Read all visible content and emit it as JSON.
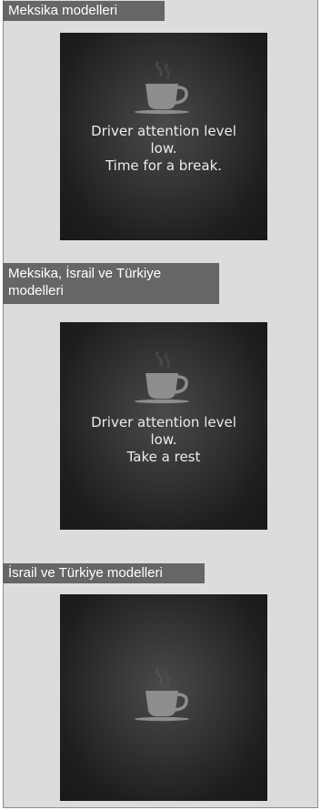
{
  "sections": [
    {
      "header": "Meksika modelleri",
      "message": [
        "Driver attention level",
        "low.",
        "Time for a break."
      ]
    },
    {
      "header_lines": [
        "Meksika, İsrail ve Türkiye",
        "modelleri"
      ],
      "message": [
        "Driver attention level",
        "low.",
        "Take a rest"
      ]
    },
    {
      "header": "İsrail ve Türkiye modelleri"
    }
  ],
  "colors": {
    "header_bg": "#666666",
    "panel_bg": "#dcdcdc",
    "screen_text": "#ebebeb",
    "cup": "#8d8d8d"
  },
  "icons": [
    "coffee-cup-icon"
  ]
}
